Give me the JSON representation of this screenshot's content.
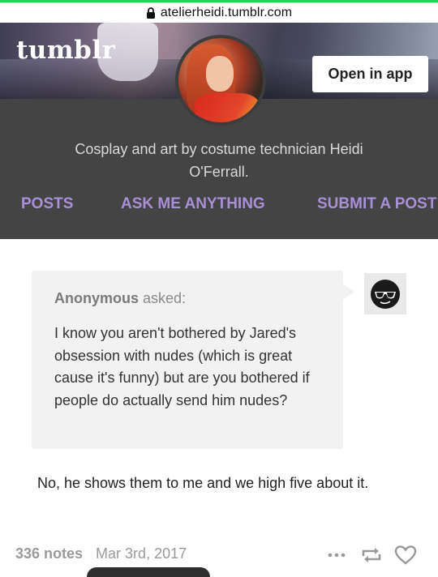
{
  "browser": {
    "url": "atelierheidi.tumblr.com"
  },
  "header": {
    "logo": "tumblr",
    "open_in_app_label": "Open in app"
  },
  "blog": {
    "description": "Cosplay and art by costume technician Heidi O'Ferrall.",
    "nav": [
      "POSTS",
      "ASK ME ANYTHING",
      "SUBMIT A POST"
    ]
  },
  "post": {
    "asker_name": "Anonymous",
    "asker_suffix": "asked:",
    "question": "I know you aren't bothered by Jared's obsession with nudes (which is great cause it's funny) but are you bothered if people do actually send him nudes?",
    "answer": "No, he shows them to me and we high five about it.",
    "notes": "336 notes",
    "date": "Mar 3rd, 2017"
  },
  "colors": {
    "accent_nav": "#a88fd6",
    "band": "#444444",
    "status_line": "#2bd34a"
  },
  "icons": [
    "lock-icon",
    "anonymous-sunglasses-icon",
    "more-dots-icon",
    "reblog-icon",
    "heart-icon"
  ]
}
